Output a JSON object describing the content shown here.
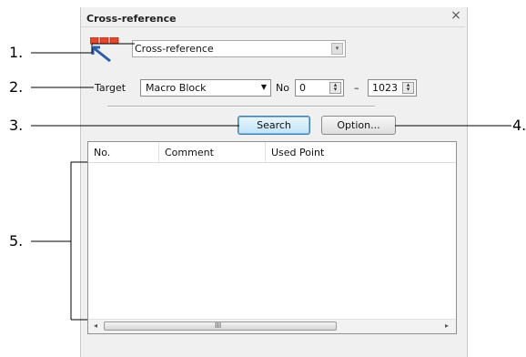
{
  "panel": {
    "title": "Cross-reference",
    "close_glyph": "×"
  },
  "reference_icon": "cross-reference-icon",
  "type_combo": {
    "value": "Cross-reference",
    "arrow_glyph": "▾"
  },
  "target_row": {
    "target_label": "Target",
    "target_value": "Macro Block",
    "no_label": "No",
    "from_value": "0",
    "dash": "–",
    "to_value": "1023"
  },
  "buttons": {
    "search_label": "Search",
    "option_label": "Option..."
  },
  "list": {
    "columns": [
      "No.",
      "Comment",
      "Used Point"
    ],
    "rows": []
  },
  "scrollbar": {
    "left_glyph": "◂",
    "right_glyph": "▸",
    "grip_glyph": "III"
  },
  "callouts": [
    "1.",
    "2.",
    "3.",
    "4.",
    "5."
  ],
  "colors": {
    "panel_bg": "#f0f0f0",
    "accent_blue": "#3c7fb1",
    "icon_red": "#e8462a"
  }
}
